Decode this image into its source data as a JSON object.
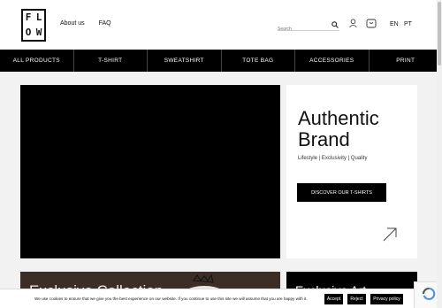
{
  "header": {
    "logo_letters": [
      "F",
      "L",
      "O",
      "W"
    ],
    "links": [
      {
        "label": "About us"
      },
      {
        "label": "FAQ"
      }
    ],
    "search": {
      "placeholder": "Search"
    },
    "languages": [
      "EN",
      "PT"
    ]
  },
  "nav": {
    "items": [
      {
        "label": "ALL PRODUCTS"
      },
      {
        "label": "T-SHIRT"
      },
      {
        "label": "SWEATSHIRT"
      },
      {
        "label": "TOTE BAG"
      },
      {
        "label": "ACCESSORIES"
      },
      {
        "label": "PRINT"
      }
    ]
  },
  "hero": {
    "title": "Authentic Brand",
    "subtitle": "Lifestyle | Exclusivity | Quality",
    "cta_label": "DISCOVER OUR T-SHIRTS"
  },
  "cards": {
    "left_title": "Exclusive Collection",
    "right_title": "Exclusive Art"
  },
  "cookie": {
    "message": "We use cookies to ensure that we give you the best experience on our website. If you continue to use this site we will assume that you are happy with it.",
    "accept_label": "Accept",
    "reject_label": "Reject",
    "privacy_label": "Privacy policy"
  },
  "colors": {
    "nav_bg": "#000000",
    "page_bg": "#f2f2f2",
    "card_brown": "#3a2e27"
  },
  "icons": [
    "search-icon",
    "user-icon",
    "cart-icon",
    "arrow-up-right-icon",
    "close-icon",
    "recaptcha-icon"
  ]
}
